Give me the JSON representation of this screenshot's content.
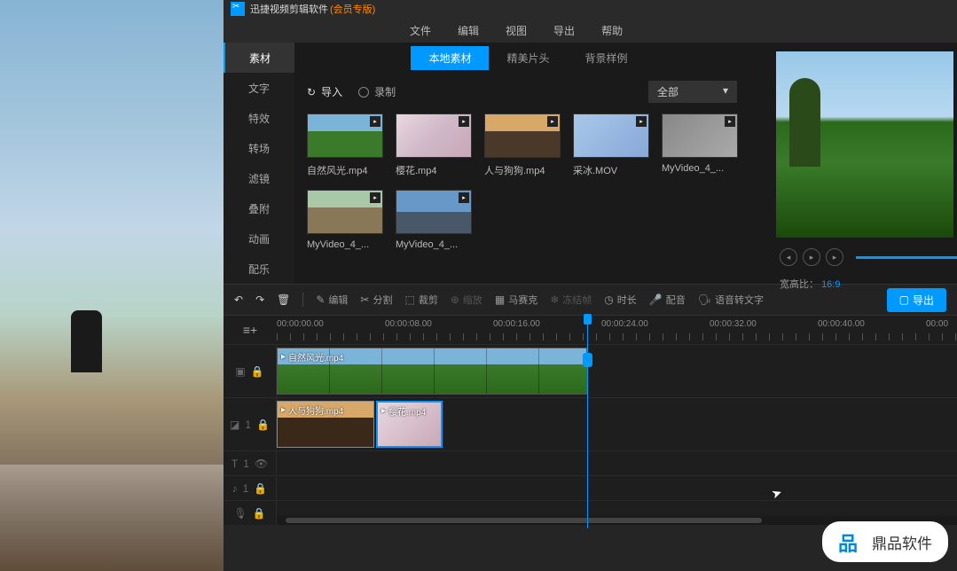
{
  "app": {
    "title": "迅捷视频剪辑软件",
    "edition": "(会员专版)"
  },
  "menu": [
    "文件",
    "编辑",
    "视图",
    "导出",
    "帮助"
  ],
  "sidebar": [
    "素材",
    "文字",
    "特效",
    "转场",
    "滤镜",
    "叠附",
    "动画",
    "配乐"
  ],
  "tabs": [
    "本地素材",
    "精美片头",
    "背景样例"
  ],
  "import_label": "导入",
  "record_label": "录制",
  "filter_label": "全部",
  "media": [
    {
      "name": "自然风光.mp4",
      "cls": "nature"
    },
    {
      "name": "樱花.mp4",
      "cls": "sakura"
    },
    {
      "name": "人与狗狗.mp4",
      "cls": "person"
    },
    {
      "name": "采冰.MOV",
      "cls": "ice"
    },
    {
      "name": "MyVideo_4_...",
      "cls": "gray"
    },
    {
      "name": "MyVideo_4_...",
      "cls": "field"
    },
    {
      "name": "MyVideo_4_...",
      "cls": "road"
    }
  ],
  "aspect": {
    "label": "宽高比：",
    "value": "16:9"
  },
  "toolbar2": {
    "edit": "编辑",
    "split": "分割",
    "crop": "裁剪",
    "zoom": "缩放",
    "mosaic": "马赛克",
    "freeze": "冻结帧",
    "duration": "时长",
    "dub": "配音",
    "speech": "语音转文字",
    "export": "导出"
  },
  "timecodes": [
    "00:00:00.00",
    "00:00:08.00",
    "00:00:16.00",
    "00:00:24.00",
    "00:00:32.00",
    "00:00:40.00",
    "00:00"
  ],
  "clips": {
    "main": "自然风光.mp4",
    "overlay1": "人与狗狗.mp4",
    "overlay2": "樱花.mp4"
  },
  "watermark": "鼎品软件"
}
